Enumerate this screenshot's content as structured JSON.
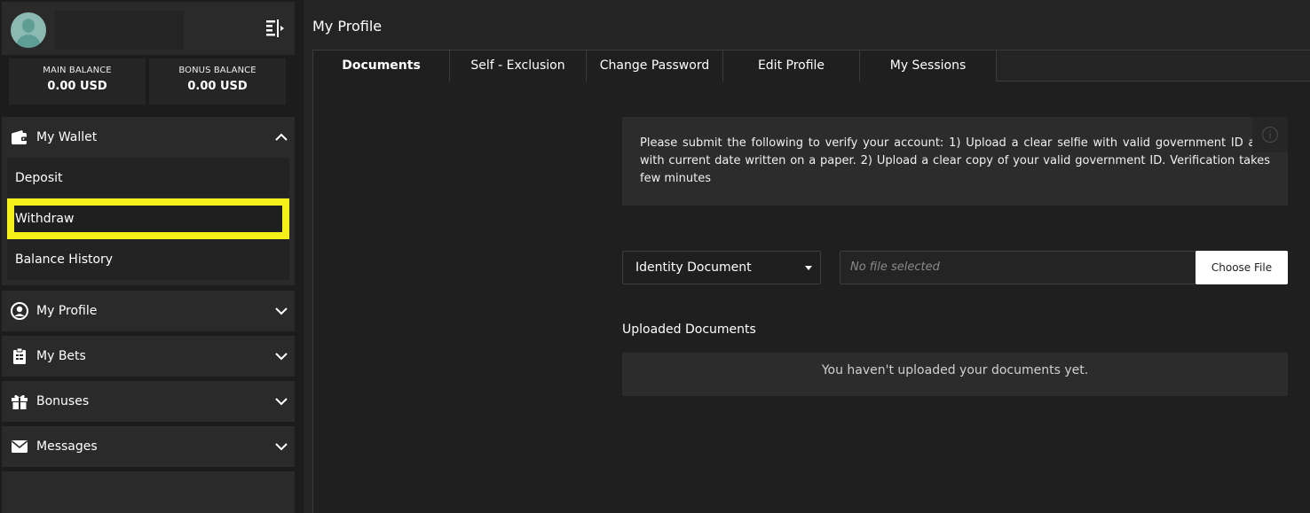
{
  "sidebar": {
    "balances": {
      "main_label": "MAIN BALANCE",
      "main_value": "0.00 USD",
      "bonus_label": "BONUS BALANCE",
      "bonus_value": "0.00 USD"
    },
    "wallet": {
      "label": "My Wallet",
      "icon": "wallet-icon",
      "expanded": true,
      "items": [
        {
          "label": "Deposit"
        },
        {
          "label": "Withdraw"
        },
        {
          "label": "Balance History"
        }
      ]
    },
    "menu": [
      {
        "label": "My Profile",
        "icon": "user-circle-icon"
      },
      {
        "label": "My Bets",
        "icon": "clipboard-icon"
      },
      {
        "label": "Bonuses",
        "icon": "gift-icon"
      },
      {
        "label": "Messages",
        "icon": "envelope-icon"
      }
    ]
  },
  "annotation": {
    "highlight_color": "#f5f01a"
  },
  "main": {
    "title": "My Profile",
    "tabs": [
      {
        "label": "Documents",
        "active": true
      },
      {
        "label": "Self - Exclusion"
      },
      {
        "label": "Change Password"
      },
      {
        "label": "Edit Profile"
      },
      {
        "label": "My Sessions"
      }
    ],
    "notice": "Please submit the following to verify your account: 1) Upload a clear selfie with valid government ID and with current date written on a paper. 2) Upload a clear copy of your valid government ID. Verification takes few minutes",
    "document_type": "Identity Document",
    "file_placeholder": "No file selected",
    "choose_file_label": "Choose File",
    "uploaded_title": "Uploaded Documents",
    "uploaded_empty": "You haven't uploaded your documents yet."
  }
}
